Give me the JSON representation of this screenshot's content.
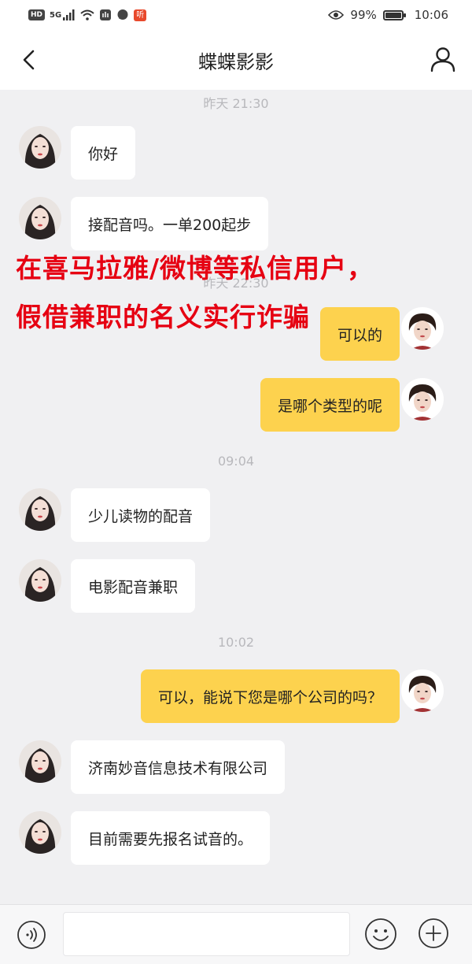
{
  "status_bar": {
    "hd_badge": "HD",
    "network": "5G",
    "app_badge": "听",
    "battery": "99%",
    "battery_level": 0.99,
    "time": "10:06",
    "icons": [
      "signal-icon",
      "wifi-icon",
      "hand-icon",
      "chat-bubble-icon",
      "eye-icon",
      "battery-icon"
    ]
  },
  "header": {
    "title": "蝶蝶影影",
    "back_icon": "chevron-left-icon",
    "profile_icon": "person-icon"
  },
  "messages": [
    {
      "type": "time",
      "text": "昨天 21:30"
    },
    {
      "type": "in",
      "text": "你好"
    },
    {
      "type": "in",
      "text": "接配音吗。一单200起步"
    },
    {
      "type": "time",
      "text": "昨天 22:30"
    },
    {
      "type": "out",
      "text": "可以的"
    },
    {
      "type": "out",
      "text": "是哪个类型的呢"
    },
    {
      "type": "time",
      "text": "09:04"
    },
    {
      "type": "in",
      "text": "少儿读物的配音"
    },
    {
      "type": "in",
      "text": "电影配音兼职"
    },
    {
      "type": "time",
      "text": "10:02"
    },
    {
      "type": "out",
      "text": "可以，能说下您是哪个公司的吗？"
    },
    {
      "type": "in",
      "text": "济南妙音信息技术有限公司"
    },
    {
      "type": "in",
      "text": "目前需要先报名试音的。"
    }
  ],
  "overlay": {
    "line1": "在喜马拉雅/微博等私信用户，",
    "line2": "假借兼职的名义实行诈骗",
    "color": "#e60012"
  },
  "input_bar": {
    "placeholder": "",
    "value": "",
    "icons": [
      "voice-icon",
      "emoji-icon",
      "plus-icon"
    ]
  },
  "colors": {
    "outgoing_bubble": "#fdd24e",
    "incoming_bubble": "#ffffff",
    "background": "#f0f0f2"
  }
}
